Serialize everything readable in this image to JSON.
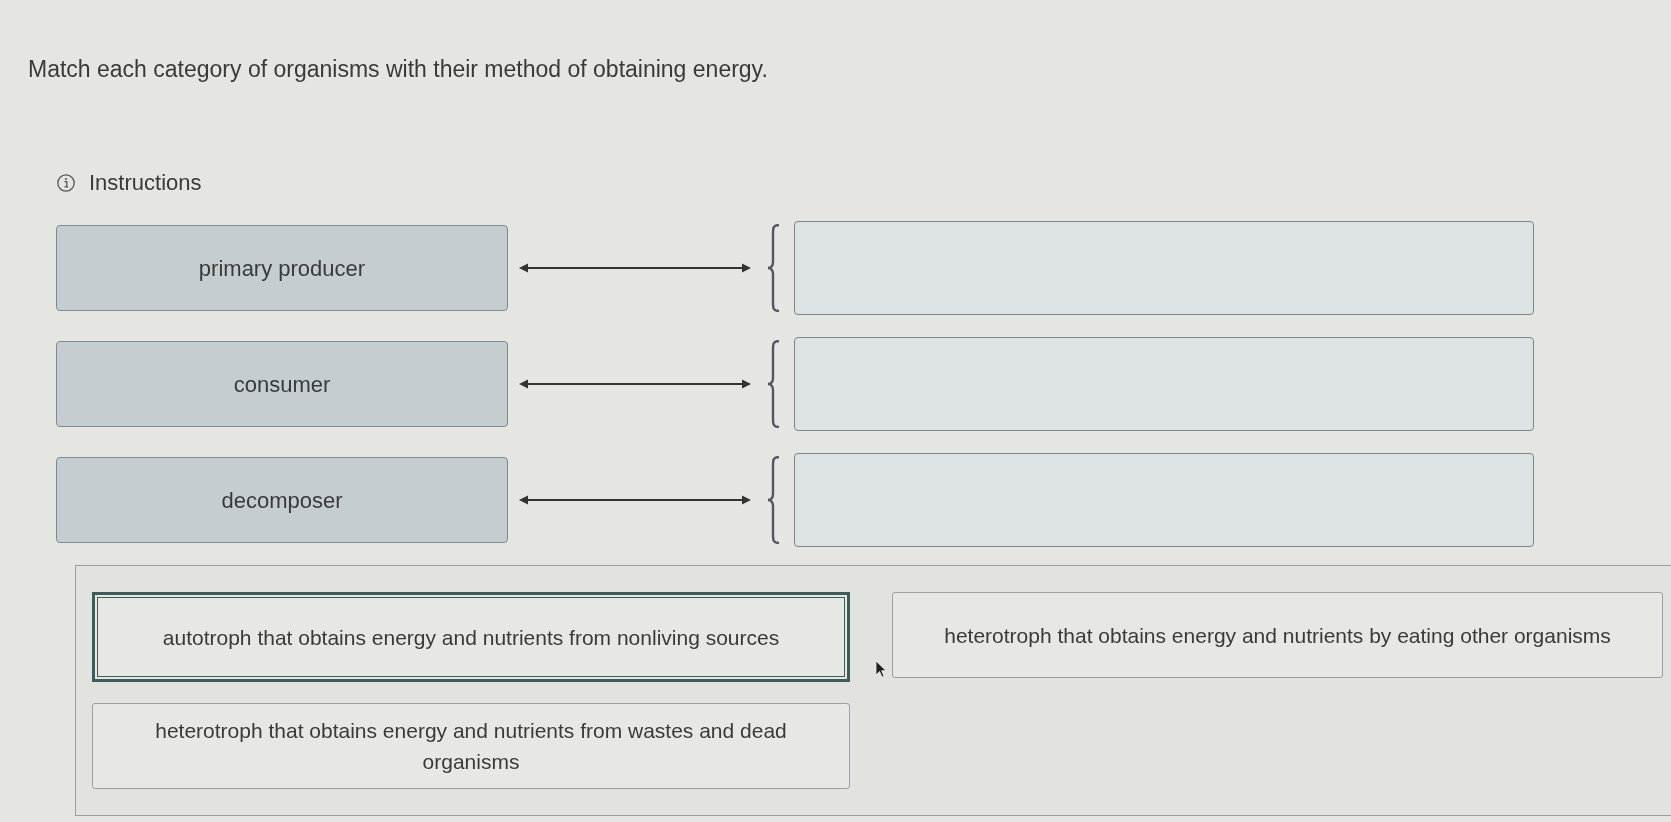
{
  "prompt": "Match each category of organisms with their method of obtaining energy.",
  "instructions": {
    "label": "Instructions"
  },
  "rows": [
    {
      "term": "primary producer"
    },
    {
      "term": "consumer"
    },
    {
      "term": "decomposer"
    }
  ],
  "choices": [
    {
      "text": "autotroph that obtains energy and nutrients from nonliving sources",
      "selected": true
    },
    {
      "text": "heterotroph that obtains energy and nutrients by eating other organisms",
      "selected": false
    },
    {
      "text": "heterotroph that obtains energy and nutrients from wastes and dead organisms",
      "selected": false
    }
  ]
}
